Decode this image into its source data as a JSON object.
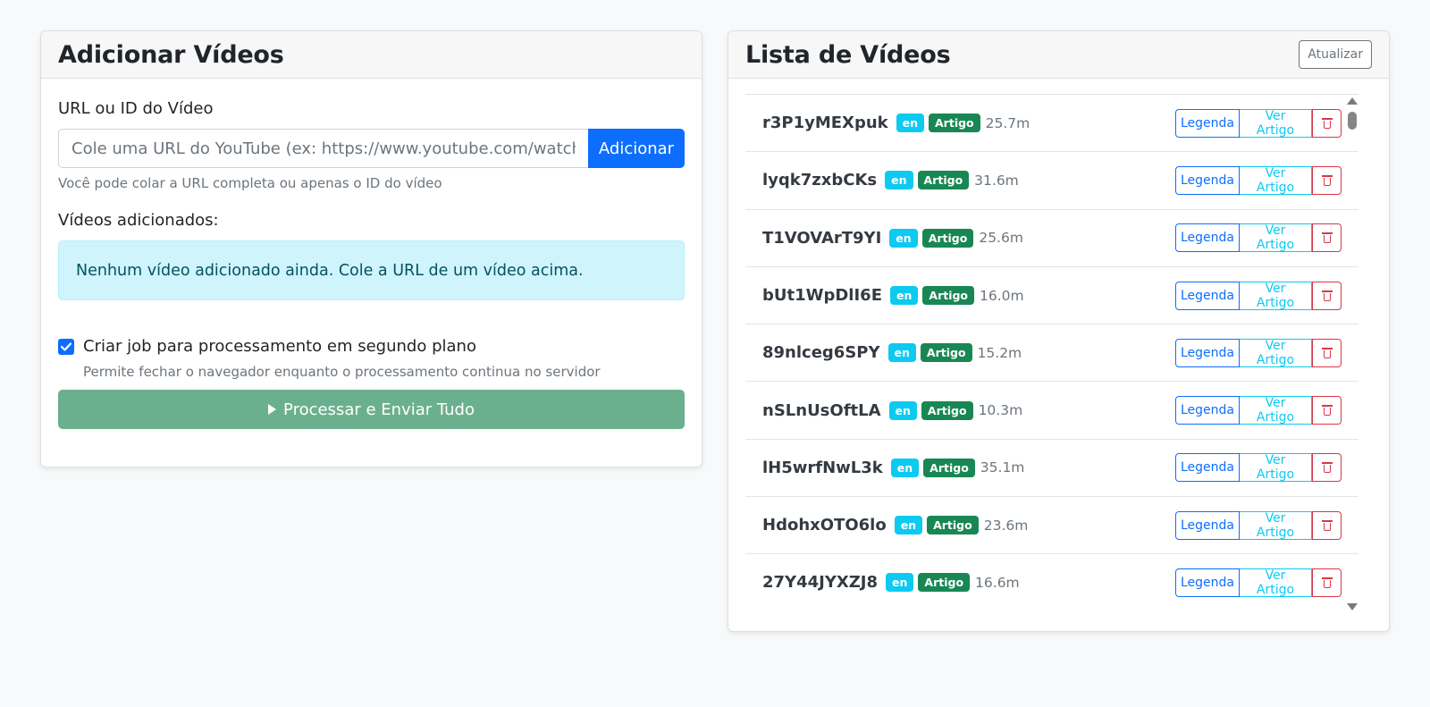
{
  "add_panel": {
    "title": "Adicionar Vídeos",
    "url_label": "URL ou ID do Vídeo",
    "url_placeholder": "Cole uma URL do YouTube (ex: https://www.youtube.com/watch?v=d",
    "add_button": "Adicionar",
    "url_help": "Você pode colar a URL completa ou apenas o ID do vídeo",
    "added_label": "Vídeos adicionados:",
    "empty_message": "Nenhum vídeo adicionado ainda. Cole a URL de um vídeo acima.",
    "background_job_checked": true,
    "background_job_label": "Criar job para processamento em segundo plano",
    "background_job_help": "Permite fechar o navegador enquanto o processamento continua no servidor",
    "process_button": "Processar e Enviar Tudo"
  },
  "list_panel": {
    "title": "Lista de Vídeos",
    "refresh_button": "Atualizar",
    "action_labels": {
      "subtitle": "Legenda",
      "article": "Ver Artigo"
    },
    "videos": [
      {
        "id": "r3P1yMEXpuk",
        "lang": "en",
        "type": "Artigo",
        "size": "25.7m"
      },
      {
        "id": "lyqk7zxbCKs",
        "lang": "en",
        "type": "Artigo",
        "size": "31.6m"
      },
      {
        "id": "T1VOVArT9YI",
        "lang": "en",
        "type": "Artigo",
        "size": "25.6m"
      },
      {
        "id": "bUt1WpDlI6E",
        "lang": "en",
        "type": "Artigo",
        "size": "16.0m"
      },
      {
        "id": "89nlceg6SPY",
        "lang": "en",
        "type": "Artigo",
        "size": "15.2m"
      },
      {
        "id": "nSLnUsOftLA",
        "lang": "en",
        "type": "Artigo",
        "size": "10.3m"
      },
      {
        "id": "lH5wrfNwL3k",
        "lang": "en",
        "type": "Artigo",
        "size": "35.1m"
      },
      {
        "id": "HdohxOTO6lo",
        "lang": "en",
        "type": "Artigo",
        "size": "23.6m"
      },
      {
        "id": "27Y44JYXZJ8",
        "lang": "en",
        "type": "Artigo",
        "size": "16.6m"
      }
    ]
  },
  "colors": {
    "primary": "#0d6efd",
    "info": "#0dcaf0",
    "success": "#198754",
    "danger": "#dc3545",
    "process_button": "#6bb08e",
    "alert_bg": "#cff4fc"
  }
}
